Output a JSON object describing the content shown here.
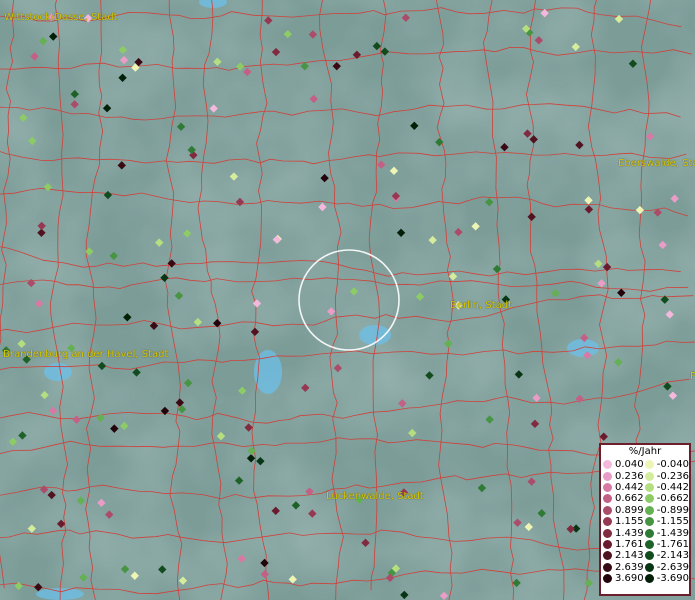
{
  "map": {
    "colors": {
      "background": "#7c9c98",
      "boundary": "#d0403a",
      "label": "#d8c800",
      "water": "#6cc0ea"
    },
    "places": [
      {
        "name": "Wittstock/Dosse, Stadt"
      },
      {
        "name": "Eberswalde, Sta"
      },
      {
        "name": "Berlin, Stadt"
      },
      {
        "name": "Brandenburg an der Havel, Stadt"
      },
      {
        "name": "F"
      },
      {
        "name": "Luckenwalde, Stadt"
      }
    ]
  },
  "legend": {
    "title": "%/Jahr",
    "positive": [
      {
        "label": "0.040",
        "color": "#f4b8dc"
      },
      {
        "label": "0.236",
        "color": "#e99cc6"
      },
      {
        "label": "0.442",
        "color": "#d67aa4"
      },
      {
        "label": "0.662",
        "color": "#c46085"
      },
      {
        "label": "0.899",
        "color": "#ab4c6a"
      },
      {
        "label": "1.155",
        "color": "#973852"
      },
      {
        "label": "1.439",
        "color": "#812a40"
      },
      {
        "label": "1.761",
        "color": "#6a1c2e"
      },
      {
        "label": "2.143",
        "color": "#521320"
      },
      {
        "label": "2.639",
        "color": "#3a0a14"
      },
      {
        "label": "3.690",
        "color": "#22040a"
      }
    ],
    "negative": [
      {
        "label": "-0.040",
        "color": "#eef5b4"
      },
      {
        "label": "-0.236",
        "color": "#d5ec9c"
      },
      {
        "label": "-0.442",
        "color": "#b5de80"
      },
      {
        "label": "-0.662",
        "color": "#8ccb66"
      },
      {
        "label": "-0.899",
        "color": "#64b052"
      },
      {
        "label": "-1.155",
        "color": "#479442"
      },
      {
        "label": "-1.439",
        "color": "#2f7a34"
      },
      {
        "label": "-1.761",
        "color": "#1e6228"
      },
      {
        "label": "-2.143",
        "color": "#124c1e"
      },
      {
        "label": "-2.639",
        "color": "#083614"
      },
      {
        "label": "-3.690",
        "color": "#022008"
      }
    ]
  }
}
